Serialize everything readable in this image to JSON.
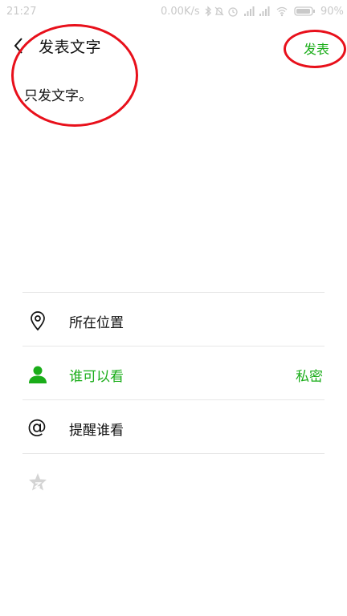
{
  "status_bar": {
    "time": "21:27",
    "network_speed": "0.00K/s",
    "battery_percent": "90%",
    "icons": [
      "bluetooth-icon",
      "do-not-disturb-icon",
      "alarm-icon",
      "signal-icon",
      "signal-icon",
      "wifi-icon",
      "battery-icon"
    ]
  },
  "header": {
    "back_icon": "chevron-left-icon",
    "title": "发表文字",
    "publish_label": "发表"
  },
  "content": {
    "text": "只发文字。"
  },
  "options": [
    {
      "icon": "location-pin-icon",
      "label": "所在位置",
      "value": ""
    },
    {
      "icon": "person-icon",
      "label": "谁可以看",
      "value": "私密"
    },
    {
      "icon": "at-icon",
      "label": "提醒谁看",
      "value": ""
    },
    {
      "icon": "star-icon",
      "label": "",
      "value": ""
    }
  ],
  "colors": {
    "accent": "#1aad19",
    "annotation": "#e8101b"
  }
}
